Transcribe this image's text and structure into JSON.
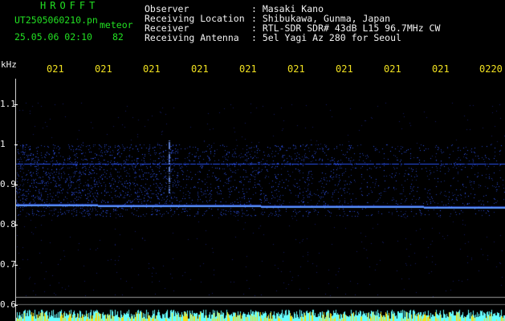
{
  "header": {
    "brand": "HROFFT",
    "filename": "UT2505060210.pn",
    "suffix": "meteor",
    "datetime": "25.05.06 02:10",
    "count": "82",
    "info": [
      {
        "label": "Observer",
        "value": ": Masaki Kano"
      },
      {
        "label": "Receiving Location",
        "value": ": Shibukawa, Gunma, Japan"
      },
      {
        "label": "Receiver",
        "value": ": RTL-SDR SDR# 43dB L15 96.7MHz CW"
      },
      {
        "label": "Receiving Antenna",
        "value": ": 5el Yagi Az 280 for Seoul"
      }
    ]
  },
  "axis": {
    "y_unit": "kHz",
    "y_ticks": [
      "1.1",
      "1",
      "0.9",
      "0.8",
      "0.7",
      "0.6"
    ],
    "y_tick_values": [
      1.1,
      1.0,
      0.9,
      0.8,
      0.7,
      0.6
    ],
    "x_ticks": [
      "021",
      "021",
      "021",
      "021",
      "021",
      "021",
      "021",
      "021",
      "021",
      "0220"
    ]
  },
  "colors": {
    "background": "#000000",
    "text_green": "#22e022",
    "text_white": "#f2f2f2",
    "text_yellow": "#f0e020",
    "signal_blue": "#3a5cff",
    "bottom_noise_cyan": "#66ffff",
    "bottom_noise_yellow": "#f0e020"
  },
  "spectrogram": {
    "carrier_freq_khz": 0.85,
    "secondary_freq_khz": 0.953,
    "noise_band_khz": [
      0.82,
      1.0
    ],
    "reference_line_khz": 0.62
  }
}
